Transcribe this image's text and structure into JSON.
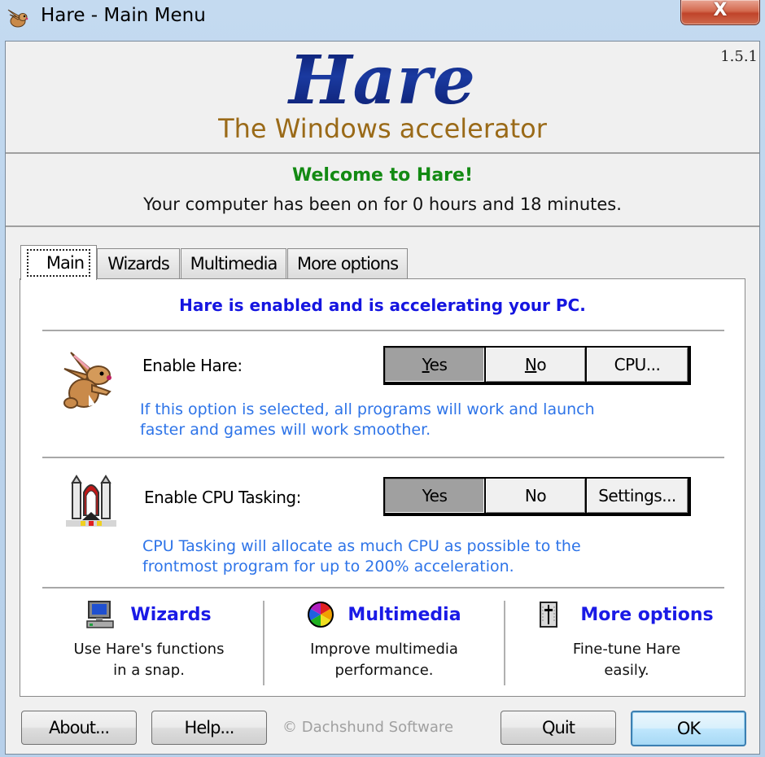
{
  "window": {
    "title": "Hare - Main Menu",
    "close_label": "X"
  },
  "header": {
    "logo": "Hare",
    "tagline": "The Windows accelerator",
    "version": "1.5.1"
  },
  "welcome": {
    "title": "Welcome to Hare!",
    "uptime": "Your computer has been on for 0 hours and 18 minutes."
  },
  "tabs": [
    {
      "label": "Main",
      "active": true
    },
    {
      "label": "Wizards",
      "active": false
    },
    {
      "label": "Multimedia",
      "active": false
    },
    {
      "label": "More options",
      "active": false
    }
  ],
  "main": {
    "status": "Hare is enabled and is accelerating your PC.",
    "enable_hare": {
      "label": "Enable Hare:",
      "buttons": [
        {
          "label_mnemonic": "Y",
          "label_rest": "es",
          "selected": true
        },
        {
          "label_mnemonic": "N",
          "label_rest": "o",
          "selected": false
        },
        {
          "label": "CPU...",
          "selected": false
        }
      ],
      "description_line1": "If this option is selected, all programs will work and launch",
      "description_line2": "faster and games will work smoother."
    },
    "cpu_tasking": {
      "label": "Enable CPU Tasking:",
      "buttons": [
        {
          "label": "Yes",
          "selected": true
        },
        {
          "label": "No",
          "selected": false
        },
        {
          "label": "Settings...",
          "selected": false
        }
      ],
      "description_line1": "CPU Tasking will allocate as much CPU as possible to the",
      "description_line2": "frontmost program for up to 200% acceleration."
    },
    "shortcuts": [
      {
        "title": "Wizards",
        "desc_line1": "Use Hare's functions",
        "desc_line2": "in a snap.",
        "icon": "computer-icon"
      },
      {
        "title": "Multimedia",
        "desc_line1": "Improve multimedia",
        "desc_line2": "performance.",
        "icon": "color-wheel-icon"
      },
      {
        "title": "More options",
        "desc_line1": "Fine-tune Hare",
        "desc_line2": "easily.",
        "icon": "tuning-panel-icon"
      }
    ]
  },
  "footer": {
    "about": "About...",
    "help": "Help...",
    "copyright": "© Dachshund Software",
    "quit": "Quit",
    "ok": "OK"
  }
}
